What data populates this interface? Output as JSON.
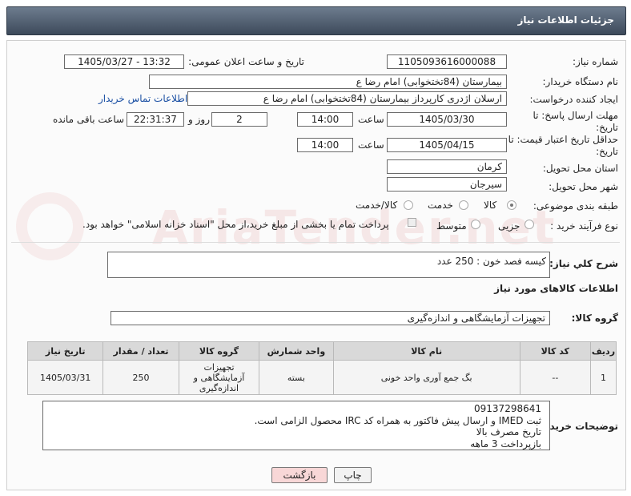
{
  "header": {
    "title": "جزئیات اطلاعات نیاز"
  },
  "fields": {
    "need_number_label": "شماره نیاز:",
    "need_number": "1105093616000088",
    "announce_label": "تاریخ و ساعت اعلان عمومی:",
    "announce_value": "1405/03/27 - 13:32",
    "buyer_org_label": "نام دستگاه خریدار:",
    "buyer_org": "بیمارستان (84تختخوابی) امام رضا  ع",
    "requester_label": "ایجاد کننده درخواست:",
    "requester": "ارسلان اژدری کارپرداز بیمارستان (84تختخوابی) امام رضا  ع",
    "contact_link": "اطلاعات تماس خریدار",
    "deadline_label": "مهلت ارسال پاسخ: تا تاریخ:",
    "deadline_date": "1405/03/30",
    "time_label": "ساعت",
    "deadline_time": "14:00",
    "days_value": "2",
    "days_label": "روز و",
    "remaining_time": "22:31:37",
    "remaining_label": "ساعت باقی مانده",
    "validity_label": "حداقل تاریخ اعتبار قیمت: تا تاریخ:",
    "validity_date": "1405/04/15",
    "validity_time": "14:00",
    "province_label": "استان محل تحویل:",
    "province": "کرمان",
    "city_label": "شهر محل تحویل:",
    "city": "سیرجان",
    "category_label": "طبقه بندی موضوعی:",
    "category_options": [
      "کالا",
      "خدمت",
      "کالا/خدمت"
    ],
    "process_label": "نوع فرآیند خرید :",
    "process_options": [
      "جزیی",
      "متوسط"
    ],
    "payment_note": "پرداخت تمام یا بخشی از مبلغ خرید،از محل \"اسناد خزانه اسلامی\" خواهد بود."
  },
  "general_desc": {
    "label": "شرح کلي نياز:",
    "value": "کیسه فصد خون : 250 عدد"
  },
  "goods_info_title": "اطلاعات کالاهای مورد نیاز",
  "goods_group": {
    "label": "گروه کالا:",
    "value": "تجهیزات آزمایشگاهی و اندازه‌گیری"
  },
  "table": {
    "headers": [
      "ردیف",
      "کد کالا",
      "نام کالا",
      "واحد شمارش",
      "گروه کالا",
      "تعداد / مقدار",
      "تاریخ نیاز"
    ],
    "rows": [
      {
        "row": "1",
        "code": "--",
        "name": "بگ جمع آوری واحد خونی",
        "unit": "بسته",
        "group": "تجهیزات آزمایشگاهی و اندازه‌گیری",
        "qty": "250",
        "date": "1405/03/31"
      }
    ]
  },
  "buyer_notes": {
    "label": "توضیحات خریدار:",
    "lines": [
      "09137298641",
      "ثبت IMED و ارسال پیش فاکتور به همراه کد IRC محصول الزامی است.",
      "تاریخ مصرف بالا",
      "بازپرداخت 3 ماهه"
    ]
  },
  "buttons": {
    "print": "چاپ",
    "back": "بازگشت"
  },
  "colors": {
    "header_bg": "#4e5b6c",
    "link": "#1a4fa3",
    "back_button_bg": "#f8d7d7"
  },
  "watermark_text": "AriaTender.net"
}
